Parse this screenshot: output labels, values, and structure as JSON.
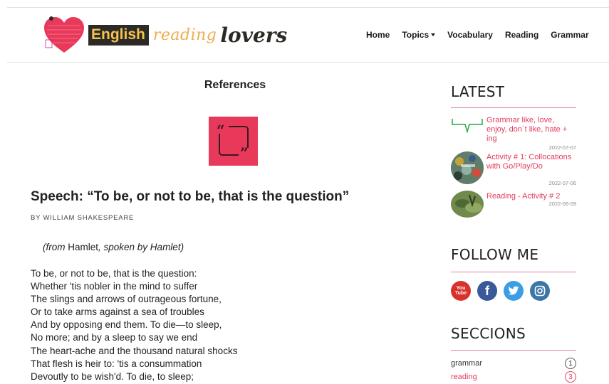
{
  "brand": {
    "word1": "English",
    "word2": "reading",
    "word3": "lovers",
    "colors": {
      "heart": "#e9395a",
      "english_bg": "#2c2a26",
      "english_text": "#f4c34d",
      "reading_text": "#f0ac50"
    }
  },
  "nav": {
    "items": [
      {
        "label": "Home"
      },
      {
        "label": "Topics"
      },
      {
        "label": "Vocabulary"
      },
      {
        "label": "Reading"
      },
      {
        "label": "Grammar"
      }
    ]
  },
  "main": {
    "heading": "References",
    "quote_icon": "quote-marks-icon",
    "speech_title": "Speech: “To be, or not to be, that is the question”",
    "byline": "BY WILLIAM SHAKESPEARE",
    "from_prefix": "(from ",
    "from_work": "Hamlet",
    "from_suffix": ", spoken by Hamlet)",
    "poem_lines": [
      "To be, or not to be, that is the question:",
      "Whether 'tis nobler in the mind to suffer",
      "The slings and arrows of outrageous fortune,",
      "Or to take arms against a sea of troubles",
      "And by opposing end them. To die—to sleep,",
      "No more; and by a sleep to say we end",
      "The heart-ache and the thousand natural shocks",
      "That flesh is heir to: 'tis a consummation",
      "Devoutly to be wish'd. To die, to sleep;"
    ]
  },
  "sidebar": {
    "latest_heading": "LATEST",
    "latest": [
      {
        "title": "Grammar like, love, enjoy, don´t like, hate + ing",
        "date": "2022-07-07"
      },
      {
        "title": "Activity # 1: Collocations with Go/Play/Do",
        "date": "2022-07-06"
      },
      {
        "title": "Reading - Activity # 2",
        "date": "2022-06-09"
      }
    ],
    "follow_heading": "FOLLOW ME",
    "social": [
      {
        "name": "youtube",
        "label_top": "You",
        "label_bottom": "Tube"
      },
      {
        "name": "facebook",
        "label": "f"
      },
      {
        "name": "twitter"
      },
      {
        "name": "instagram"
      }
    ],
    "sections_heading": "SECCIONS",
    "sections": [
      {
        "label": "grammar",
        "count": "1",
        "color": "#333333"
      },
      {
        "label": "reading",
        "count": "3",
        "color": "#e33d5e"
      }
    ],
    "accent": "#e33d5e"
  }
}
